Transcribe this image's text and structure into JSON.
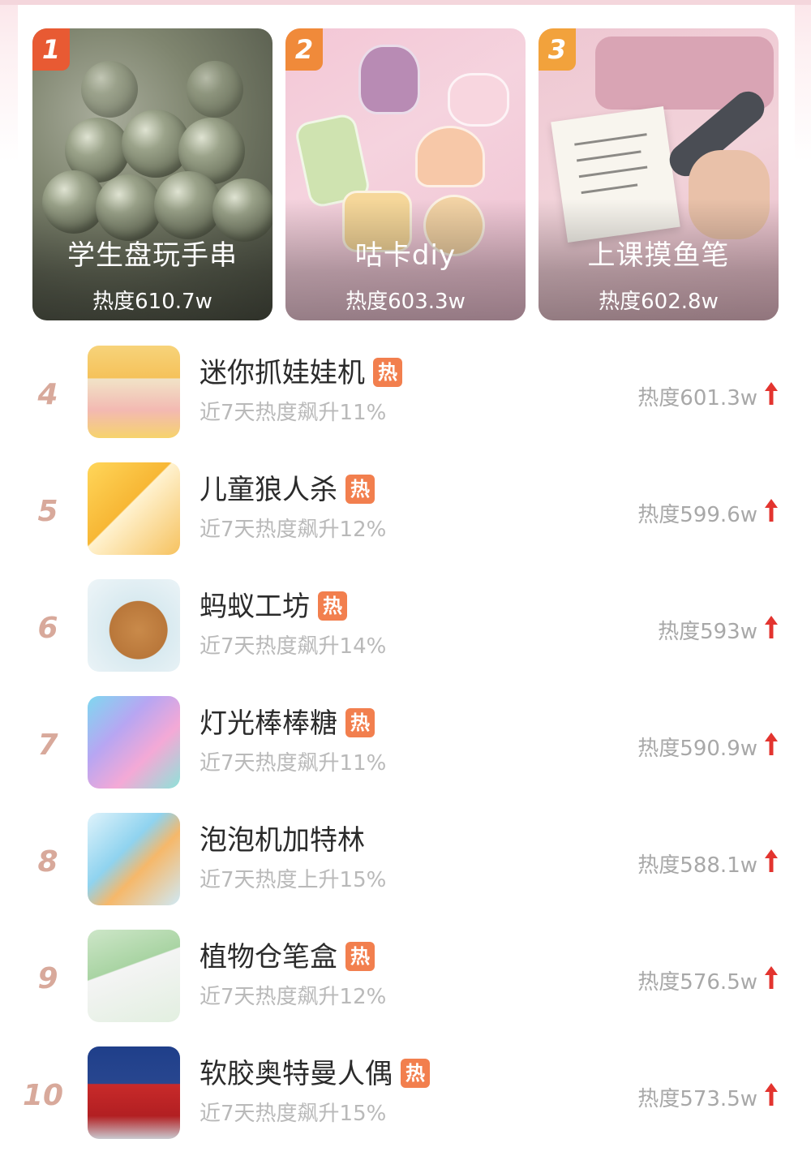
{
  "top3": [
    {
      "rank": "1",
      "title": "学生盘玩手串",
      "heat": "热度610.7w"
    },
    {
      "rank": "2",
      "title": "咕卡diy",
      "heat": "热度603.3w"
    },
    {
      "rank": "3",
      "title": "上课摸鱼笔",
      "heat": "热度602.8w"
    }
  ],
  "list": [
    {
      "rank": "4",
      "name": "迷你抓娃娃机",
      "hot": "热",
      "trend": "近7天热度飙升11%",
      "heat": "热度601.3w"
    },
    {
      "rank": "5",
      "name": "儿童狼人杀",
      "hot": "热",
      "trend": "近7天热度飙升12%",
      "heat": "热度599.6w"
    },
    {
      "rank": "6",
      "name": "蚂蚁工坊",
      "hot": "热",
      "trend": "近7天热度飙升14%",
      "heat": "热度593w"
    },
    {
      "rank": "7",
      "name": "灯光棒棒糖",
      "hot": "热",
      "trend": "近7天热度飙升11%",
      "heat": "热度590.9w"
    },
    {
      "rank": "8",
      "name": "泡泡机加特林",
      "hot": "",
      "trend": "近7天热度上升15%",
      "heat": "热度588.1w"
    },
    {
      "rank": "9",
      "name": "植物仓笔盒",
      "hot": "热",
      "trend": "近7天热度飙升12%",
      "heat": "热度576.5w"
    },
    {
      "rank": "10",
      "name": "软胶奥特曼人偶",
      "hot": "热",
      "trend": "近7天热度飙升15%",
      "heat": "热度573.5w"
    }
  ],
  "icons": {
    "up_arrow": "up-arrow-icon",
    "hot_badge": "hot-badge"
  },
  "colors": {
    "rank_badge_1": "#e85a33",
    "rank_badge_2": "#f08a3a",
    "rank_badge_3": "#f2a23c",
    "hot_tag": "#f27f4e",
    "up_arrow": "#e3342f",
    "rank_number": "#d8a99b"
  }
}
